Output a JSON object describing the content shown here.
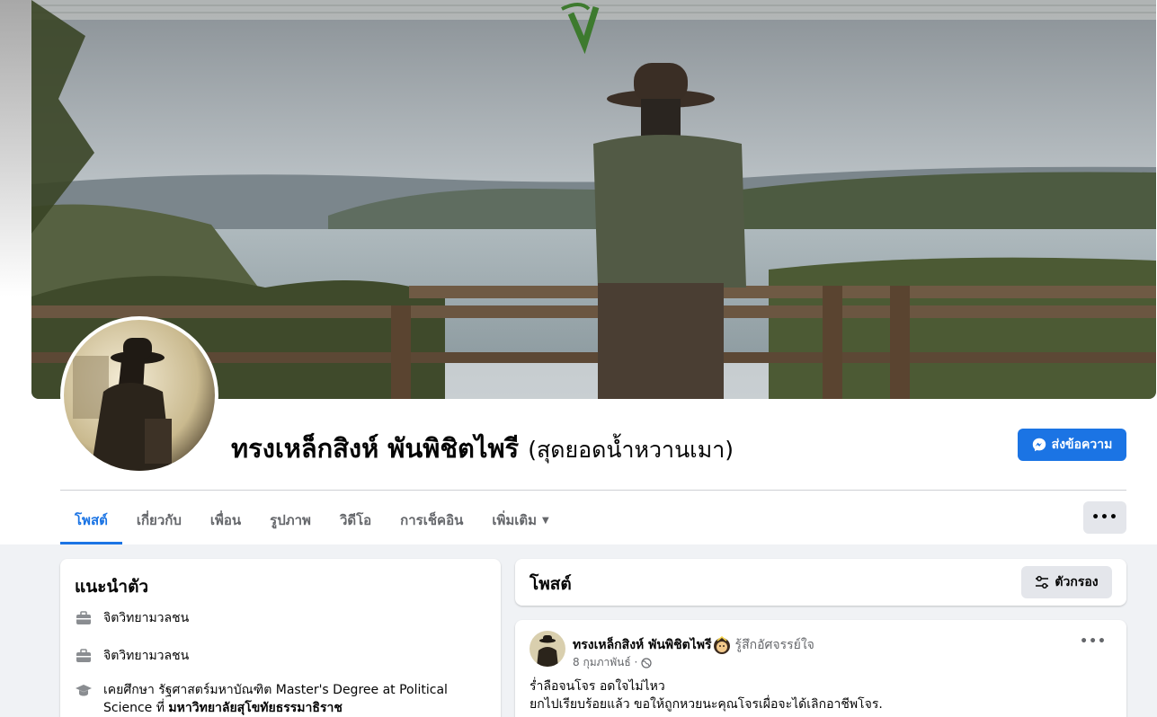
{
  "profile": {
    "name": "ทรงเหล็กสิงห์ พันพิชิตไพรี",
    "alternate_name": "(สุดยอดน้ำหวานเมา)"
  },
  "actions": {
    "message_label": "ส่งข้อความ",
    "more_label": "•••"
  },
  "tabs": [
    {
      "label": "โพสต์",
      "active": true
    },
    {
      "label": "เกี่ยวกับ"
    },
    {
      "label": "เพื่อน"
    },
    {
      "label": "รูปภาพ"
    },
    {
      "label": "วิดีโอ"
    },
    {
      "label": "การเช็คอิน"
    },
    {
      "label": "เพิ่มเติม"
    }
  ],
  "intro": {
    "title": "แนะนำตัว",
    "items": [
      {
        "icon": "briefcase-icon",
        "text": "จิตวิทยามวลชน"
      },
      {
        "icon": "briefcase-icon",
        "text": "จิตวิทยามวลชน"
      },
      {
        "icon": "graduation-cap-icon",
        "text": "เคยศึกษา รัฐศาสตร์มหาบัณฑิต Master's Degree at Political Science ที่",
        "bold": "มหาวิทยาลัยสุโขทัยธรรมาธิราช"
      }
    ]
  },
  "posts": {
    "title": "โพสต์",
    "filter_label": "ตัวกรอง",
    "items": [
      {
        "author": "ทรงเหล็กสิงห์ พันพิชิตไพรี",
        "feeling": "รู้สึกอัศจรรย์ใจ",
        "date": "8 กุมภาพันธ์ ·",
        "lines": [
          "ร่ำลือจนโจร อดใจไม่ไหว",
          "ยกไปเรียบร้อยแล้ว ขอให้ถูกหวยนะคุณโจรเผื่อจะได้เลิกอาชีพโจร."
        ]
      }
    ]
  },
  "colors": {
    "accent": "#1b74e4",
    "page_bg": "#f0f2f5",
    "secondary_text": "#65676b",
    "button_gray": "#e4e6eb"
  }
}
